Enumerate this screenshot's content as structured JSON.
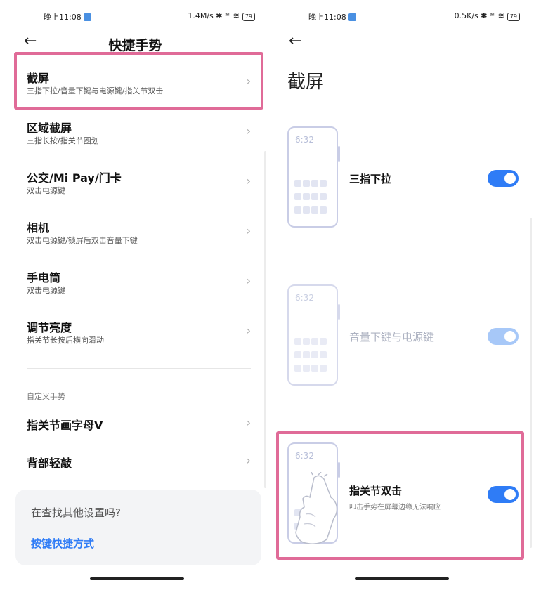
{
  "left": {
    "status": {
      "time": "晚上11:08",
      "right": "1.4M/s ✱ ᵃⁱˡ ≋",
      "battery": "79"
    },
    "back_icon": "←",
    "title": "快捷手势",
    "items": [
      {
        "title": "截屏",
        "sub": "三指下拉/音量下键与电源键/指关节双击"
      },
      {
        "title": "区域截屏",
        "sub": "三指长按/指关节圈划"
      },
      {
        "title": "公交/Mi Pay/门卡",
        "sub": "双击电源键"
      },
      {
        "title": "相机",
        "sub": "双击电源键/锁屏后双击音量下键"
      },
      {
        "title": "手电筒",
        "sub": "双击电源键"
      },
      {
        "title": "调节亮度",
        "sub": "指关节长按后横向滑动"
      }
    ],
    "section_label": "自定义手势",
    "custom_items": [
      {
        "title": "指关节画字母V"
      },
      {
        "title": "背部轻敲"
      }
    ],
    "card": {
      "question": "在查找其他设置吗?",
      "link": "按键快捷方式"
    },
    "chevron": "›"
  },
  "right": {
    "status": {
      "time": "晚上11:08",
      "right": "0.5K/s ✱ ᵃⁱˡ ≋",
      "battery": "79"
    },
    "back_icon": "←",
    "title": "截屏",
    "rows": [
      {
        "clock": "6:32",
        "label": "三指下拉",
        "desc": "",
        "toggle_on": true,
        "enabled": true
      },
      {
        "clock": "6:32",
        "label": "音量下键与电源键",
        "desc": "",
        "toggle_on": true,
        "enabled": false
      },
      {
        "clock": "6:32",
        "label": "指关节双击",
        "desc": "叩击手势在屏幕边缘无法响应",
        "toggle_on": true,
        "enabled": true
      }
    ]
  },
  "colors": {
    "accent": "#2f7cf6",
    "highlight": "#e06b98",
    "toggle_disabled": "#a7c8f8"
  }
}
